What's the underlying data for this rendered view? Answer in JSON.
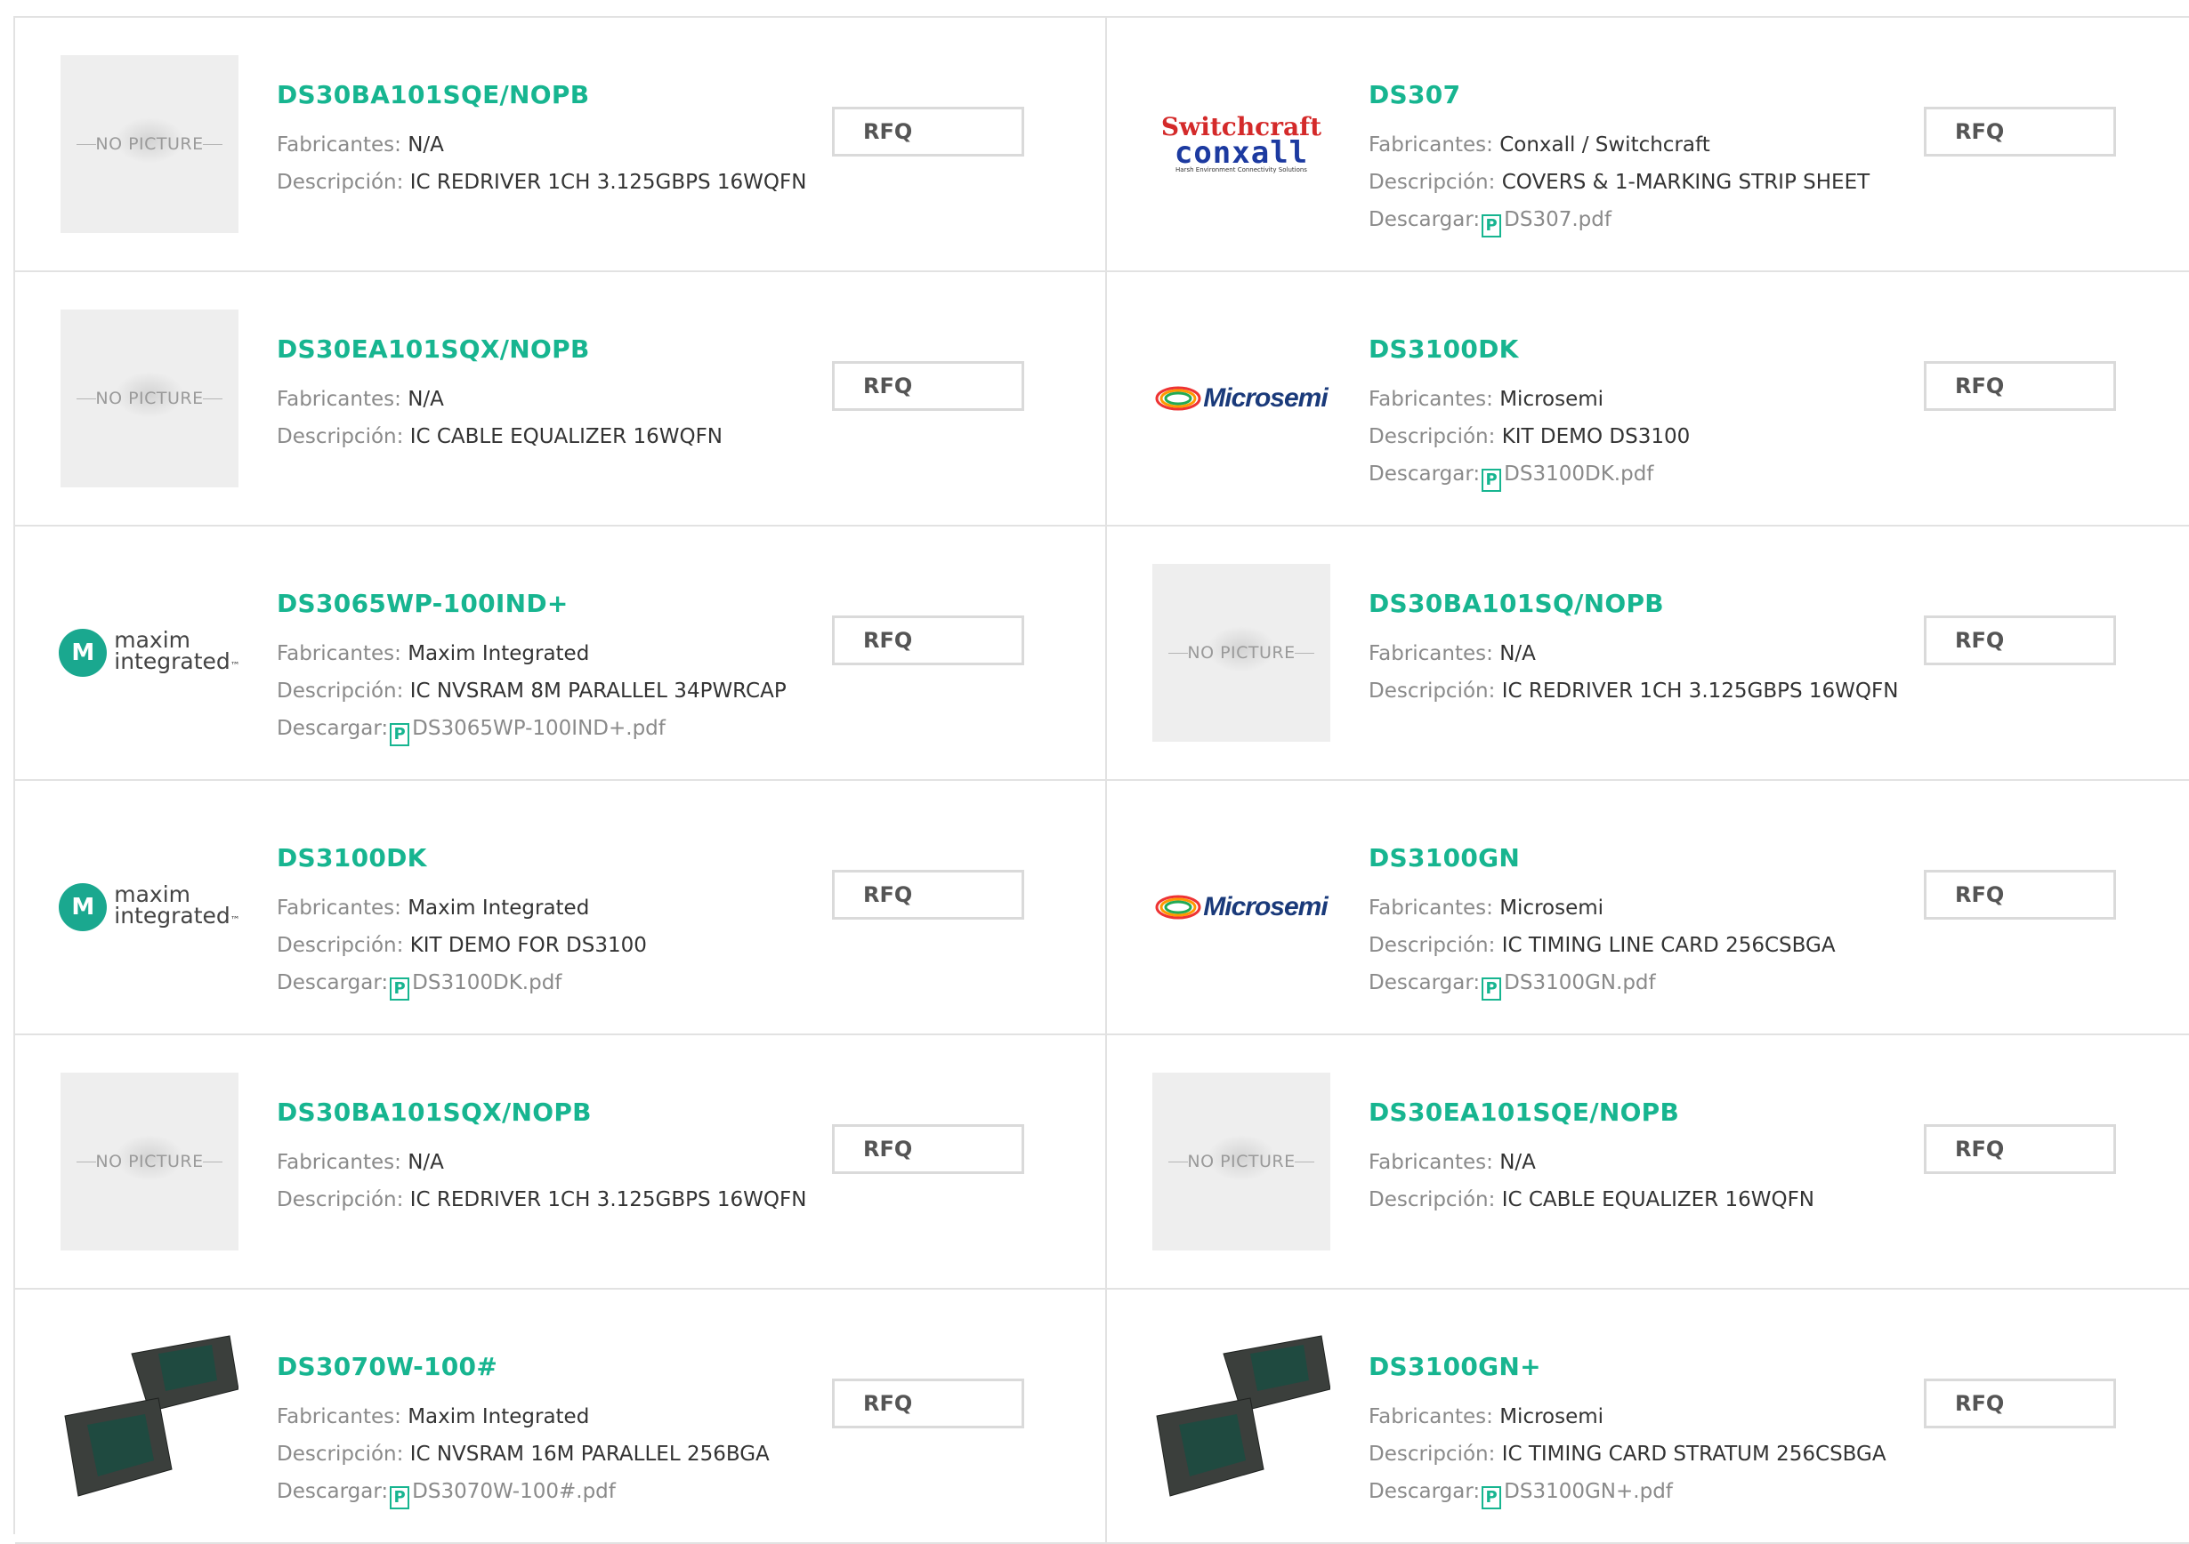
{
  "labels": {
    "manufacturer": "Fabricantes:",
    "description": "Descripción:",
    "download": "Descargar:",
    "rfq": "RFQ",
    "no_picture": "NO PICTURE",
    "pdf_glyph": "P"
  },
  "logos": {
    "maxim": {
      "badge": "M",
      "line1": "maxim",
      "line2": "integrated",
      "tm": "™"
    },
    "microsemi": {
      "text": "Microsemi"
    },
    "switchcraft": {
      "line1": "Switchcraft",
      "line2": "conxall",
      "tagline": "Harsh Environment Connectivity Solutions"
    }
  },
  "colors": {
    "part_link": "#17b590",
    "label": "#8a8a8a",
    "text": "#333333",
    "border": "#e2e2e2"
  },
  "items": [
    {
      "part": "DS30BA101SQE/NOPB",
      "manufacturer": "N/A",
      "description": "IC REDRIVER 1CH 3.125GBPS 16WQFN",
      "pdf": null,
      "image": "no-picture"
    },
    {
      "part": "DS307",
      "manufacturer": "Conxall / Switchcraft",
      "description": "COVERS & 1-MARKING STRIP SHEET",
      "pdf": "DS307.pdf",
      "image": "switchcraft-logo"
    },
    {
      "part": "DS30EA101SQX/NOPB",
      "manufacturer": "N/A",
      "description": "IC CABLE EQUALIZER 16WQFN",
      "pdf": null,
      "image": "no-picture"
    },
    {
      "part": "DS3100DK",
      "manufacturer": "Microsemi",
      "description": "KIT DEMO DS3100",
      "pdf": "DS3100DK.pdf",
      "image": "microsemi-logo"
    },
    {
      "part": "DS3065WP-100IND+",
      "manufacturer": "Maxim Integrated",
      "description": "IC NVSRAM 8M PARALLEL 34PWRCAP",
      "pdf": "DS3065WP-100IND+.pdf",
      "image": "maxim-logo"
    },
    {
      "part": "DS30BA101SQ/NOPB",
      "manufacturer": "N/A",
      "description": "IC REDRIVER 1CH 3.125GBPS 16WQFN",
      "pdf": null,
      "image": "no-picture"
    },
    {
      "part": "DS3100DK",
      "manufacturer": "Maxim Integrated",
      "description": "KIT DEMO FOR DS3100",
      "pdf": "DS3100DK.pdf",
      "image": "maxim-logo"
    },
    {
      "part": "DS3100GN",
      "manufacturer": "Microsemi",
      "description": "IC TIMING LINE CARD 256CSBGA",
      "pdf": "DS3100GN.pdf",
      "image": "microsemi-logo"
    },
    {
      "part": "DS30BA101SQX/NOPB",
      "manufacturer": "N/A",
      "description": "IC REDRIVER 1CH 3.125GBPS 16WQFN",
      "pdf": null,
      "image": "no-picture"
    },
    {
      "part": "DS30EA101SQE/NOPB",
      "manufacturer": "N/A",
      "description": "IC CABLE EQUALIZER 16WQFN",
      "pdf": null,
      "image": "no-picture"
    },
    {
      "part": "DS3070W-100#",
      "manufacturer": "Maxim Integrated",
      "description": "IC NVSRAM 16M PARALLEL 256BGA",
      "pdf": "DS3070W-100#.pdf",
      "image": "bga-chip-photo"
    },
    {
      "part": "DS3100GN+",
      "manufacturer": "Microsemi",
      "description": "IC TIMING CARD STRATUM 256CSBGA",
      "pdf": "DS3100GN+.pdf",
      "image": "bga-chip-photo"
    }
  ]
}
